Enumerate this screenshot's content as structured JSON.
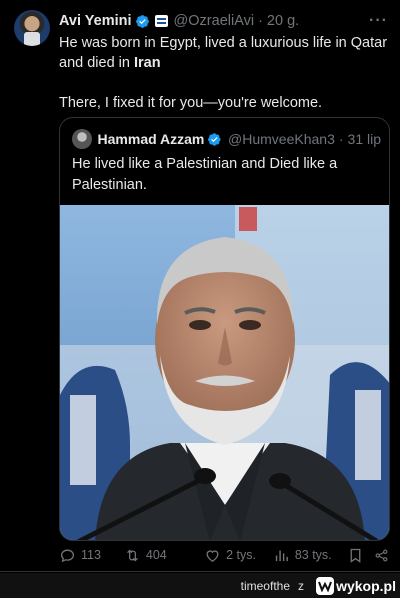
{
  "tweet": {
    "author_name": "Avi Yemini",
    "handle": "@OzraeliAvi",
    "separator": "·",
    "time": "20 g.",
    "more_label": "···",
    "line1": "He was born in Egypt, lived a luxurious life in Qatar",
    "line2_prefix": "and died in ",
    "line2_bold": "Iran",
    "line3": "There, I fixed it for you—you're welcome."
  },
  "quote": {
    "author_name": "Hammad Azzam",
    "handle": "@HumveeKhan3",
    "separator": "·",
    "time": "31 lip",
    "text_line1": "He lived like a Palestinian and Died like a",
    "text_line2": "Palestinian."
  },
  "actions": {
    "replies": "113",
    "reposts": "404",
    "likes": "2 tys.",
    "views": "83 tys."
  },
  "footer": {
    "username": "timeofthe",
    "via": "z",
    "site": "wykop.pl"
  },
  "colors": {
    "background": "#000000",
    "text": "#e7e9ea",
    "muted": "#71767b",
    "verified": "#1d9bf0",
    "border": "#2f3336"
  }
}
